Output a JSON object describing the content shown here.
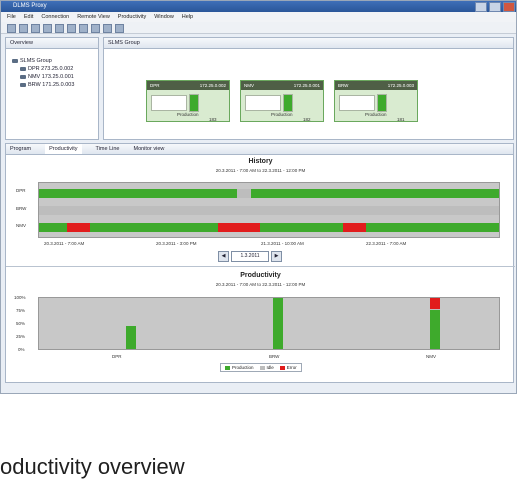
{
  "window": {
    "title": "DLMS Proxy"
  },
  "menu": [
    "File",
    "Edit",
    "Connection",
    "Remote View",
    "Productivity",
    "Window",
    "Help"
  ],
  "left_pane": {
    "tab": "Overview",
    "tree": {
      "root": "SLMS Group",
      "children": [
        "DPR 273.25.0.002",
        "NMV 173.25.0.001",
        "BRW 171.25.0.003"
      ]
    }
  },
  "top_pane": {
    "tab": "SLMS Group",
    "machines": [
      {
        "name": "DPR",
        "ip": "172.25.0.002",
        "status": "Production",
        "value": "183"
      },
      {
        "name": "NMV",
        "ip": "172.25.0.001",
        "status": "Production",
        "value": "182"
      },
      {
        "name": "BRW",
        "ip": "172.25.0.003",
        "status": "Production",
        "value": "181"
      }
    ]
  },
  "bottom_tabs": [
    "Program",
    "Productivity",
    "Time Line",
    "Monitor view"
  ],
  "history": {
    "title": "History",
    "subtitle": "20.3.2011 - 7:00 AM to 22.3.2011 - 12:00 PM",
    "rows": [
      "DPR",
      "BRW",
      "NMV"
    ],
    "x_ticks": [
      "20.3.2011 - 7:00 AM",
      "20.3.2011 - 3:00 PM",
      "21.3.2011 - 10:00 AM",
      "22.3.2011 - 7:00 AM"
    ],
    "segments": [
      [
        {
          "state": "production",
          "start": 0.0,
          "end": 0.43
        },
        {
          "state": "idle",
          "start": 0.43,
          "end": 0.46
        },
        {
          "state": "production",
          "start": 0.46,
          "end": 1.0
        }
      ],
      [
        {
          "state": "idle",
          "start": 0.0,
          "end": 1.0
        }
      ],
      [
        {
          "state": "production",
          "start": 0.0,
          "end": 0.06
        },
        {
          "state": "error",
          "start": 0.06,
          "end": 0.11
        },
        {
          "state": "production",
          "start": 0.11,
          "end": 0.39
        },
        {
          "state": "error",
          "start": 0.39,
          "end": 0.48
        },
        {
          "state": "production",
          "start": 0.48,
          "end": 0.66
        },
        {
          "state": "error",
          "start": 0.66,
          "end": 0.71
        },
        {
          "state": "production",
          "start": 0.71,
          "end": 1.0
        }
      ]
    ],
    "nav": {
      "prev": "◀",
      "date": "1.3.2011",
      "next": "▶"
    }
  },
  "productivity": {
    "title": "Productivity",
    "subtitle": "20.3.2011 - 7:00 AM to 22.3.2011 - 12:00 PM",
    "y_ticks": [
      "100%",
      "75%",
      "50%",
      "25%",
      "0%"
    ],
    "legend": [
      "Production",
      "Idle",
      "Error"
    ]
  },
  "colors": {
    "production": "#3eaa2c",
    "error": "#e11c1c",
    "idle": "#bdbdbd"
  },
  "chart_data": {
    "type": "bar",
    "categories": [
      "DPR",
      "BRW",
      "NMV"
    ],
    "series": [
      {
        "name": "Production",
        "values": [
          46,
          100,
          76
        ]
      },
      {
        "name": "Idle",
        "values": [
          0,
          0,
          2
        ]
      },
      {
        "name": "Error",
        "values": [
          0,
          0,
          22
        ]
      }
    ],
    "title": "Productivity",
    "ylabel": "",
    "ylim": [
      0,
      100
    ]
  },
  "caption": "oductivity overview"
}
